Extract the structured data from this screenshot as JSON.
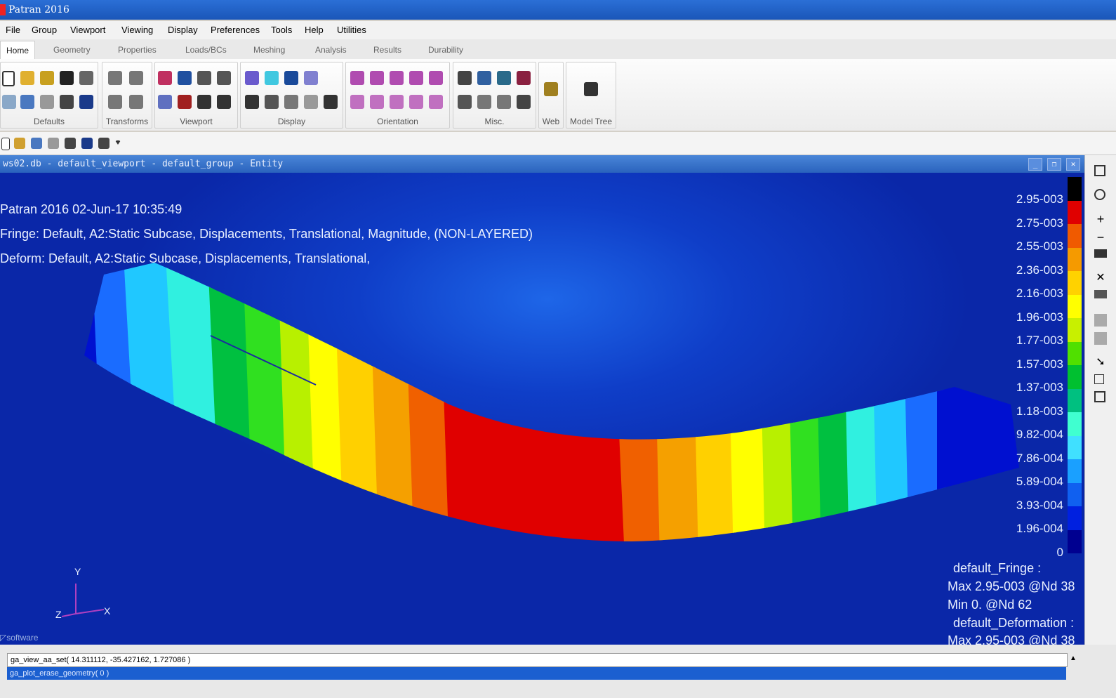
{
  "window": {
    "title": "Patran 2016"
  },
  "menu": [
    "File",
    "Group",
    "Viewport",
    "Viewing",
    "Display",
    "Preferences",
    "Tools",
    "Help",
    "Utilities"
  ],
  "tabs": [
    "Home",
    "Geometry",
    "Properties",
    "Loads/BCs",
    "Meshing",
    "Analysis",
    "Results",
    "Durability"
  ],
  "ribbon_groups": [
    "Defaults",
    "Transforms",
    "Viewport",
    "Display",
    "Orientation",
    "Misc.",
    "Web",
    "Model Tree"
  ],
  "viewport": {
    "title": "ws02.db - default_viewport - default_group - Entity",
    "header_lines": [
      "Patran 2016 02-Jun-17 10:35:49",
      "Fringe: Default, A2:Static Subcase, Displacements, Translational, Magnitude, (NON-LAYERED)",
      "Deform: Default, A2:Static Subcase, Displacements, Translational,"
    ],
    "axis": {
      "y": "Y",
      "x": "X",
      "z": "Z"
    },
    "watermark": "software",
    "summary": [
      "default_Fringe :",
      "Max 2.95-003 @Nd 38",
      "Min 0. @Nd 62",
      "default_Deformation :",
      "Max 2.95-003 @Nd 38"
    ]
  },
  "legend": {
    "values": [
      "2.95-003",
      "2.75-003",
      "2.55-003",
      "2.36-003",
      "2.16-003",
      "1.96-003",
      "1.77-003",
      "1.57-003",
      "1.37-003",
      "1.18-003",
      "9.82-004",
      "7.86-004",
      "5.89-004",
      "3.93-004",
      "1.96-004",
      "0"
    ],
    "colors": [
      "#000000",
      "#e00000",
      "#f05a00",
      "#f59a00",
      "#ffd200",
      "#ffff00",
      "#c8f000",
      "#50e000",
      "#00c030",
      "#00c080",
      "#40ffd0",
      "#40e0ff",
      "#1aa0ff",
      "#1060f0",
      "#0020e0",
      "#000090"
    ]
  },
  "command": {
    "line1": "ga_view_aa_set( 14.311112, -35.427162, 1.727086 )",
    "line2": "ga_plot_erase_geometry( 0 )"
  }
}
